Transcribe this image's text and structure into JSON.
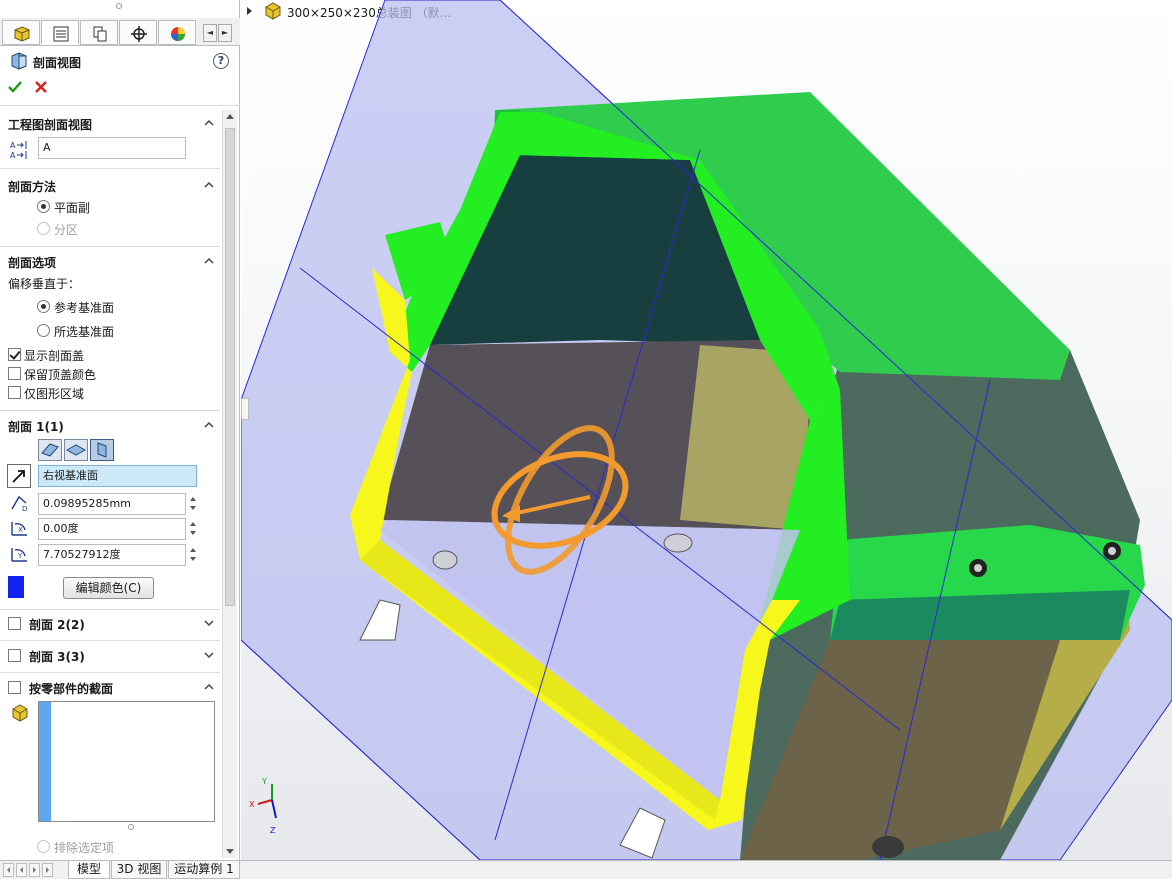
{
  "panel": {
    "title": "剖面视图",
    "help": "?",
    "groups": {
      "drawing_section": {
        "title": "工程图剖面视图",
        "label_value": "A"
      },
      "method": {
        "title": "剖面方法",
        "options": [
          "平面副",
          "分区"
        ]
      },
      "options": {
        "title": "剖面选项",
        "offset_label": "偏移垂直于：",
        "radios": [
          "参考基准面",
          "所选基准面"
        ],
        "checks": [
          "显示剖面盖",
          "保留顶盖颜色",
          "仅图形区域"
        ]
      },
      "section1": {
        "title": "剖面 1(1)",
        "reference": "右视基准面",
        "offset": "0.09895285mm",
        "angle_x": "0.00度",
        "angle_y": "7.70527912度",
        "edit_color": "编辑颜色(C)",
        "cap_color": "#1122ee"
      },
      "section2": {
        "title": "剖面 2(2)"
      },
      "section3": {
        "title": "剖面 3(3)"
      },
      "by_component": {
        "title": "按零部件的截面",
        "exclude": "排除选定项"
      }
    }
  },
  "viewport": {
    "tree_label": "300×250×230总装图 （默..."
  },
  "bottom_tabs": [
    "模型",
    "3D 视图",
    "运动算例 1"
  ],
  "colors": {
    "section_plane": "#b9bcf0",
    "cap_green": "#22ee22",
    "cap_yellow": "#f7f71c",
    "accent": "#3a7bd5"
  }
}
